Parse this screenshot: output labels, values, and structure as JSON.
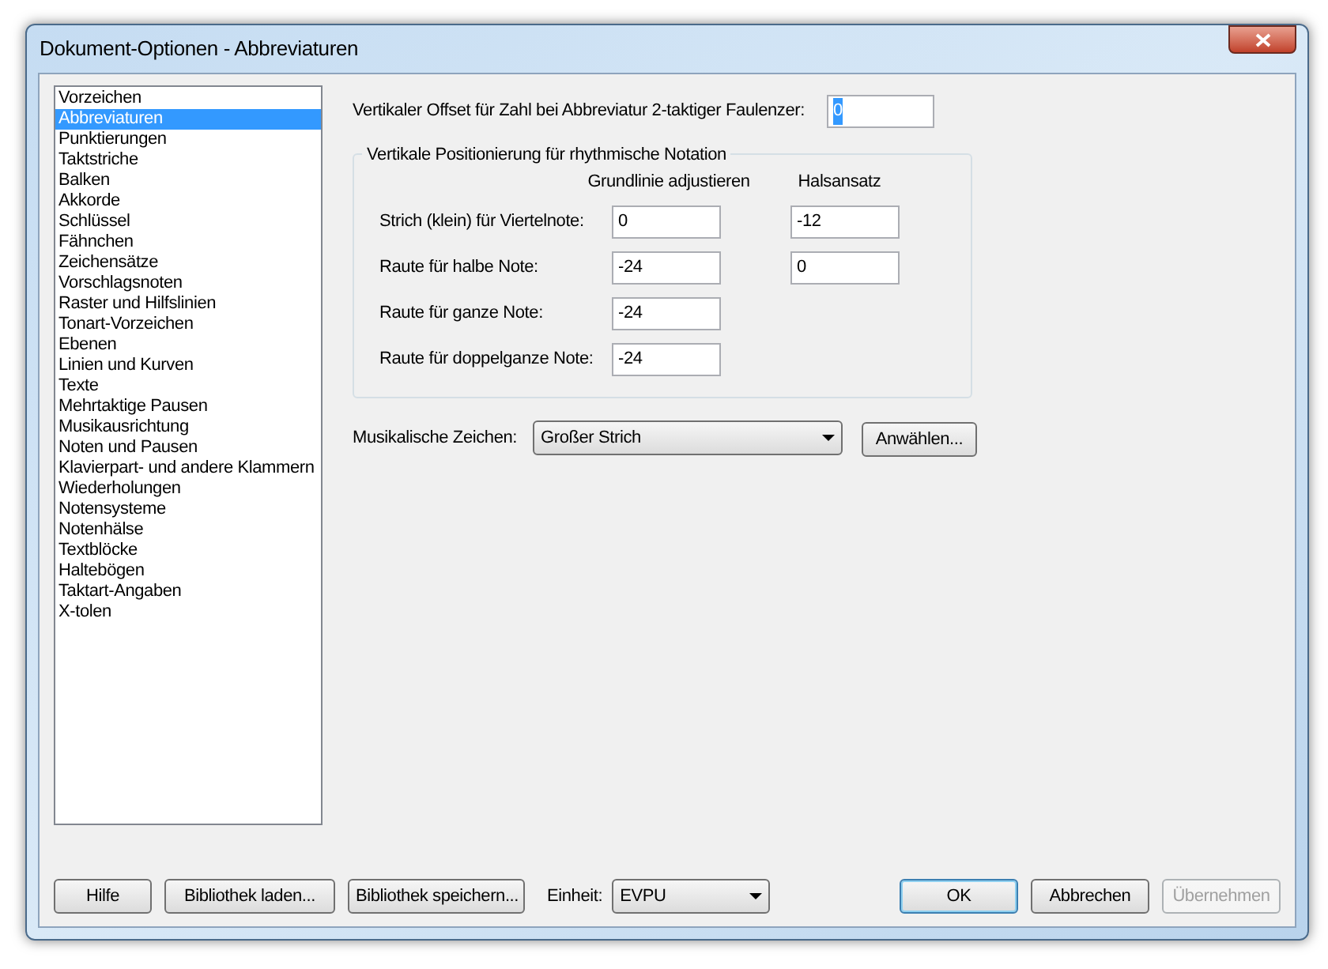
{
  "window": {
    "title": "Dokument-Optionen - Abbreviaturen"
  },
  "sidebar": {
    "items": [
      {
        "label": "Vorzeichen",
        "selected": false
      },
      {
        "label": "Abbreviaturen",
        "selected": true
      },
      {
        "label": "Punktierungen",
        "selected": false
      },
      {
        "label": "Taktstriche",
        "selected": false
      },
      {
        "label": "Balken",
        "selected": false
      },
      {
        "label": "Akkorde",
        "selected": false
      },
      {
        "label": "Schlüssel",
        "selected": false
      },
      {
        "label": "Fähnchen",
        "selected": false
      },
      {
        "label": "Zeichensätze",
        "selected": false
      },
      {
        "label": "Vorschlagsnoten",
        "selected": false
      },
      {
        "label": "Raster und Hilfslinien",
        "selected": false
      },
      {
        "label": "Tonart-Vorzeichen",
        "selected": false
      },
      {
        "label": "Ebenen",
        "selected": false
      },
      {
        "label": "Linien und Kurven",
        "selected": false
      },
      {
        "label": "Texte",
        "selected": false
      },
      {
        "label": "Mehrtaktige Pausen",
        "selected": false
      },
      {
        "label": "Musikausrichtung",
        "selected": false
      },
      {
        "label": "Noten und Pausen",
        "selected": false
      },
      {
        "label": "Klavierpart- und andere Klammern",
        "selected": false
      },
      {
        "label": "Wiederholungen",
        "selected": false
      },
      {
        "label": "Notensysteme",
        "selected": false
      },
      {
        "label": "Notenhälse",
        "selected": false
      },
      {
        "label": "Textblöcke",
        "selected": false
      },
      {
        "label": "Haltebögen",
        "selected": false
      },
      {
        "label": "Taktart-Angaben",
        "selected": false
      },
      {
        "label": "X-tolen",
        "selected": false
      }
    ]
  },
  "offset": {
    "label": "Vertikaler Offset für Zahl bei Abbreviatur 2-taktiger Faulenzer:",
    "value": "0"
  },
  "group": {
    "title": "Vertikale Positionierung für rhythmische Notation",
    "columns": [
      "Grundlinie adjustieren",
      "Halsansatz"
    ],
    "rows": [
      {
        "label": "Strich (klein) für Viertelnote:",
        "values": [
          "0",
          "-12"
        ]
      },
      {
        "label": "Raute für halbe Note:",
        "values": [
          "-24",
          "0"
        ]
      },
      {
        "label": "Raute für ganze Note:",
        "values": [
          "-24"
        ]
      },
      {
        "label": "Raute für doppelganze Note:",
        "values": [
          "-24"
        ]
      }
    ]
  },
  "symbol": {
    "label": "Musikalische Zeichen:",
    "value": "Großer Strich",
    "button": "Anwählen..."
  },
  "footer": {
    "left_buttons": [
      "Hilfe",
      "Bibliothek laden...",
      "Bibliothek speichern..."
    ],
    "unit_label": "Einheit:",
    "unit_value": "EVPU",
    "right_buttons": [
      {
        "label": "OK",
        "default": true,
        "disabled": false
      },
      {
        "label": "Abbrechen",
        "default": false,
        "disabled": false
      },
      {
        "label": "Übernehmen",
        "default": false,
        "disabled": true
      }
    ]
  }
}
